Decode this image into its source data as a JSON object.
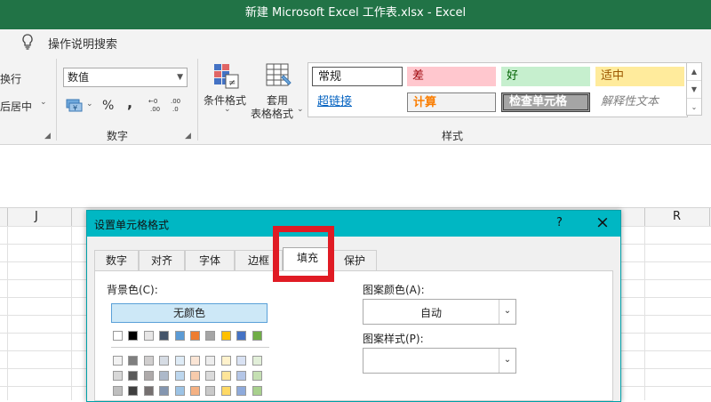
{
  "window": {
    "title": "新建 Microsoft Excel 工作表.xlsx  -  Excel"
  },
  "tellme": {
    "label": "操作说明搜索"
  },
  "ribbon": {
    "wrap_text": "换行",
    "merge_center": "后居中",
    "number_format_value": "数值",
    "currency_symbol": "¥",
    "percent_symbol": "%",
    "comma_symbol": ",",
    "inc_decimal": ".00",
    "dec_decimal": ".0",
    "number_group_label": "数字",
    "conditional_format": "条件格式",
    "format_as_table_1": "套用",
    "format_as_table_2": "表格格式",
    "styles_group_label": "样式",
    "cell_styles": [
      {
        "label": "常规"
      },
      {
        "label": "差"
      },
      {
        "label": "好"
      },
      {
        "label": "适中"
      },
      {
        "label": "超链接"
      },
      {
        "label": "计算"
      },
      {
        "label": "检查单元格"
      },
      {
        "label": "解释性文本"
      }
    ]
  },
  "columns": {
    "j": "J",
    "r": "R"
  },
  "dialog": {
    "title": "设置单元格格式",
    "help": "?",
    "close": "×",
    "tabs": [
      "数字",
      "对齐",
      "字体",
      "边框",
      "填充",
      "保护"
    ],
    "active_tab": "填充",
    "background_color_label": "背景色(C):",
    "no_color_button": "无颜色",
    "pattern_color_label": "图案颜色(A):",
    "pattern_color_value": "自动",
    "pattern_style_label": "图案样式(P):",
    "pattern_style_value": "",
    "theme_colors_row1": [
      "#ffffff",
      "#000000",
      "#e7e6e6",
      "#44546a",
      "#5b9bd5",
      "#ed7d31",
      "#a5a5a5",
      "#ffc000",
      "#4472c4",
      "#70ad47"
    ],
    "theme_colors_row2": [
      "#f2f2f2",
      "#7f7f7f",
      "#d0cece",
      "#d6dce4",
      "#deebf6",
      "#fbe5d5",
      "#ededed",
      "#fff2cc",
      "#d9e2f3",
      "#e2efd9"
    ],
    "theme_colors_row3": [
      "#d8d8d8",
      "#595959",
      "#aeaaaa",
      "#adb9ca",
      "#bdd7ee",
      "#f7cbac",
      "#dbdbdb",
      "#fee599",
      "#b4c6e7",
      "#c5e0b3"
    ],
    "theme_colors_row4": [
      "#bfbfbf",
      "#3f3f3f",
      "#757070",
      "#8496b0",
      "#9cc3e5",
      "#f4b183",
      "#c9c9c9",
      "#ffd965",
      "#8eaadb",
      "#a8d08d"
    ]
  },
  "colors": {
    "excel_green": "#217346",
    "dialog_title": "#00b7c3",
    "highlight": "#e01b24"
  }
}
